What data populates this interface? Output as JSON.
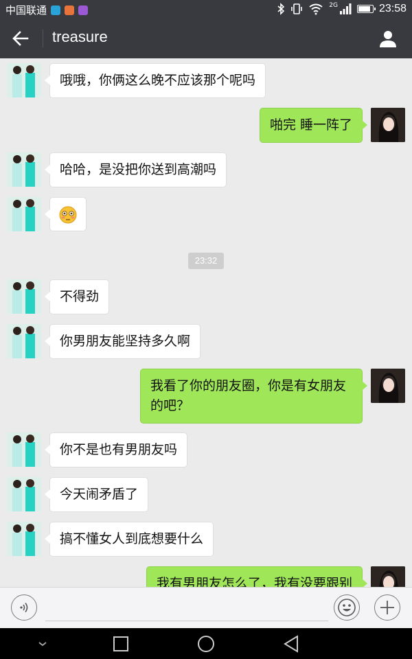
{
  "status_bar": {
    "carrier": "中国联通",
    "network": "2G",
    "time": "23:58",
    "battery_level": 0.9
  },
  "header": {
    "title": "treasure"
  },
  "messages": [
    {
      "side": "in",
      "text": "哦哦，你俩这么晚不应该那个呢吗"
    },
    {
      "side": "out",
      "text": "啪完 睡一阵了"
    },
    {
      "side": "in",
      "text": "哈哈，是没把你送到高潮吗"
    },
    {
      "side": "in",
      "emoji": "😳"
    },
    {
      "timestamp": "23:32"
    },
    {
      "side": "in",
      "text": "不得劲"
    },
    {
      "side": "in",
      "text": "你男朋友能坚持多久啊"
    },
    {
      "side": "out",
      "text_line1": "我看了你的朋友圈，你是有女朋友",
      "text_line2": "的吧？"
    },
    {
      "side": "in",
      "text": "你不是也有男朋友吗"
    },
    {
      "side": "in",
      "text": "今天闹矛盾了"
    },
    {
      "side": "in",
      "text": "搞不懂女人到底想要什么"
    },
    {
      "side": "out",
      "text": "我有男朋友怎么了，我有没要跟别"
    }
  ],
  "colors": {
    "header_bg": "#393a3f",
    "chat_bg": "#ebebeb",
    "out_bubble": "#9fe658",
    "in_bubble": "#ffffff"
  }
}
